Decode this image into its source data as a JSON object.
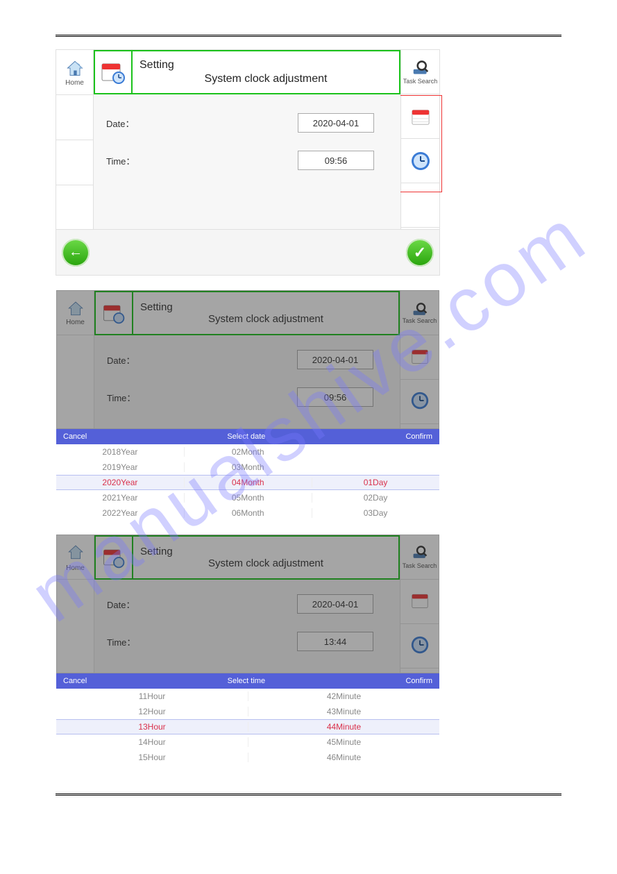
{
  "watermark": "manualshive.com",
  "screen1": {
    "home_label": "Home",
    "tasksearch_label": "Task Search",
    "setting_label": "Setting",
    "subtitle": "System clock adjustment",
    "date_label": "Date：",
    "date_value": "2020-04-01",
    "time_label": "Time：",
    "time_value": "09:56"
  },
  "screen2": {
    "home_label": "Home",
    "tasksearch_label": "Task Search",
    "setting_label": "Setting",
    "subtitle": "System clock adjustment",
    "date_label": "Date：",
    "date_value": "2020-04-01",
    "time_label": "Time：",
    "time_value": "09:56",
    "bar_cancel": "Cancel",
    "bar_title": "Select date",
    "bar_confirm": "Confirm",
    "years": [
      "2018Year",
      "2019Year",
      "2020Year",
      "2021Year",
      "2022Year"
    ],
    "months": [
      "02Month",
      "03Month",
      "04Month",
      "05Month",
      "06Month"
    ],
    "days": [
      "",
      "",
      "01Day",
      "02Day",
      "03Day"
    ],
    "selected_index": 2
  },
  "screen3": {
    "home_label": "Home",
    "tasksearch_label": "Task Search",
    "setting_label": "Setting",
    "subtitle": "System clock adjustment",
    "date_label": "Date：",
    "date_value": "2020-04-01",
    "time_label": "Time：",
    "time_value": "13:44",
    "bar_cancel": "Cancel",
    "bar_title": "Select time",
    "bar_confirm": "Confirm",
    "hours": [
      "11Hour",
      "12Hour",
      "13Hour",
      "14Hour",
      "15Hour"
    ],
    "minutes": [
      "42Minute",
      "43Minute",
      "44Minute",
      "45Minute",
      "46Minute"
    ],
    "selected_index": 2
  }
}
